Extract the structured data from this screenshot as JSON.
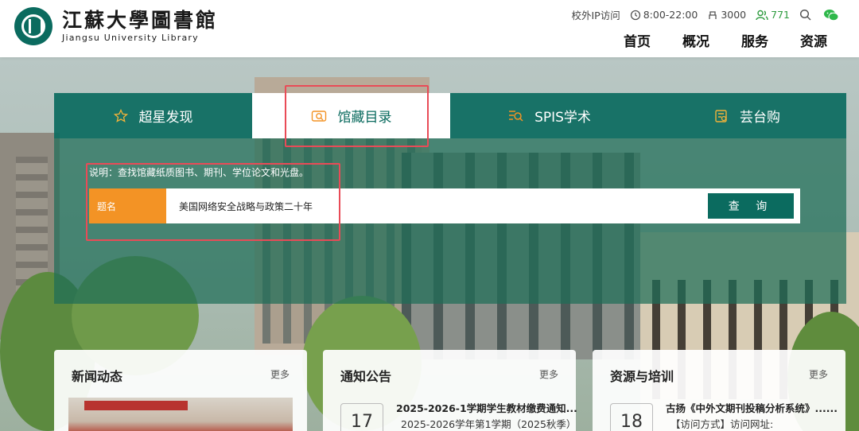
{
  "brand": {
    "name_cn": "江蘇大學圖書館",
    "name_en": "Jiangsu University Library",
    "color": "#0b6b5f"
  },
  "topbar": {
    "offcampus": "校外IP访问",
    "hours": "8:00-22:00",
    "seats": "3000",
    "online": "771",
    "icons": [
      "clock-icon",
      "seat-icon",
      "users-icon",
      "search-icon",
      "wechat-icon"
    ]
  },
  "nav": [
    "首页",
    "概况",
    "服务",
    "资源"
  ],
  "tabs": [
    {
      "label": "超星发现",
      "icon": "star-icon"
    },
    {
      "label": "馆藏目录",
      "icon": "catalog-icon",
      "active": true
    },
    {
      "label": "SPIS学术",
      "icon": "spis-icon"
    },
    {
      "label": "芸台购",
      "icon": "shop-icon"
    }
  ],
  "search": {
    "hint": "说明：查找馆藏纸质图书、期刊、学位论文和光盘。",
    "field": "题名",
    "value": "美国网络安全战略与政策二十年",
    "button": "查 询"
  },
  "cards": {
    "news": {
      "title": "新闻动态",
      "more": "更多"
    },
    "notice": {
      "title": "通知公告",
      "more": "更多",
      "date": "17",
      "item_title": "2025-2026-1学期学生教材缴费通知...",
      "item_sub": "2025-2026学年第1学期（2025秋季）"
    },
    "resource": {
      "title": "资源与培训",
      "more": "更多",
      "date": "18",
      "item_title": "古扬《中外文期刊投稿分析系统》......",
      "item_sub": "【访问方式】访问网址:"
    }
  },
  "colors": {
    "accent": "#0b6b5f",
    "orange": "#f39325",
    "highlight": "#e94b57",
    "online_green": "#2e9b3f"
  }
}
